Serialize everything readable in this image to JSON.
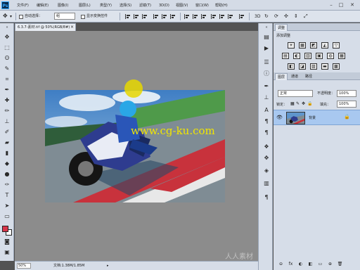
{
  "menubar": {
    "logo": "Ps",
    "items": [
      "文件(F)",
      "编辑(E)",
      "图像(I)",
      "图层(L)",
      "类型(Y)",
      "选择(S)",
      "滤镜(T)",
      "3D(D)",
      "视图(V)",
      "窗口(W)",
      "帮助(H)"
    ],
    "window_buttons": [
      "–",
      "□",
      "✕"
    ]
  },
  "options": {
    "auto_select_label": "自动选择：",
    "auto_select_value": "组",
    "show_transform_label": "显示变换控件"
  },
  "document": {
    "tab_title": "6.3.7-素材.tif @ 50%(RGB/8#)",
    "tab_close": "×",
    "watermark": "www.cg-ku.com"
  },
  "status": {
    "zoom": "50%",
    "doc_info": "文档:1.38M/1.85M",
    "arrow": "▸"
  },
  "colors": {
    "foreground": "#d7354a",
    "background": "#ffffff",
    "layer_selected": "#a8c8f0",
    "canvas_bg": "#8c8c8c"
  },
  "panels": {
    "top_tab": "调整",
    "adjust_title": "添加调整",
    "adjust_icons_row1": [
      "☀",
      "▦",
      "◩",
      "◭",
      "▽"
    ],
    "adjust_icons_row2": [
      "▤",
      "◐",
      "▥",
      "▣",
      "◍",
      "▦"
    ],
    "adjust_icons_row3": [
      "◧",
      "◪",
      "▨",
      "▬",
      "▩"
    ],
    "layer_tabs": [
      "图层",
      "通道",
      "路径"
    ],
    "blend_mode": "正常",
    "opacity_label": "不透明度：",
    "opacity_value": "100%",
    "lock_label": "锁定：",
    "fill_label": "填充：",
    "fill_value": "100%",
    "layer_name": "背景",
    "bottom_icons": [
      "⊖",
      "fx",
      "◐",
      "◧",
      "▭",
      "⊕",
      "🗑"
    ]
  },
  "logo_text": "人人素材"
}
